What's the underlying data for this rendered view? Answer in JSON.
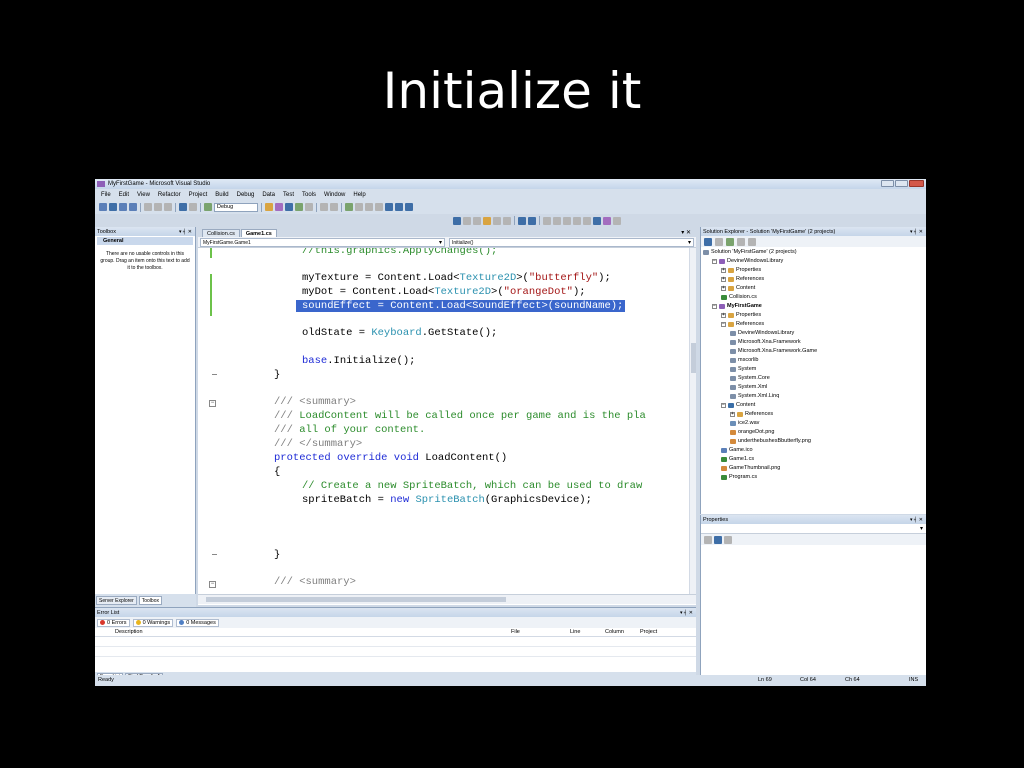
{
  "slide": {
    "title": "Initialize it"
  },
  "window": {
    "title": "MyFirstGame - Microsoft Visual Studio"
  },
  "menu": [
    "File",
    "Edit",
    "View",
    "Refactor",
    "Project",
    "Build",
    "Debug",
    "Data",
    "Test",
    "Tools",
    "Window",
    "Help"
  ],
  "toolbar": {
    "config": "Debug"
  },
  "toolbox": {
    "title": "Toolbox",
    "group": "General",
    "note": "There are no usable controls in this group. Drag an item onto this text to add it to the toolbox.",
    "tabs": [
      "Server Explorer",
      "Toolbox"
    ]
  },
  "editor": {
    "tabs": [
      "Collision.cs",
      "Game1.cs"
    ],
    "class_combo": "MyFirstGame.Game1",
    "member_combo": "Initialize()"
  },
  "error_list": {
    "title": "Error List",
    "errors": "0 Errors",
    "warnings": "0 Warnings",
    "messages": "0 Messages",
    "columns": [
      "Description",
      "File",
      "Line",
      "Column",
      "Project"
    ],
    "tabs": [
      "Error List",
      "Find Results 1"
    ]
  },
  "solution_explorer": {
    "title": "Solution Explorer - Solution 'MyFirstGame' (2 projects)",
    "items": [
      "Solution 'MyFirstGame' (2 projects)",
      "DevineWindowsLibrary",
      "Properties",
      "References",
      "Content",
      "Collision.cs",
      "MyFirstGame",
      "Properties",
      "References",
      "DevineWindowsLibrary",
      "Microsoft.Xna.Framework",
      "Microsoft.Xna.Framework.Game",
      "mscorlib",
      "System",
      "System.Core",
      "System.Xml",
      "System.Xml.Linq",
      "Content",
      "References",
      "ice2.wav",
      "orangeDot.png",
      "underthebushesBbutterfly.png",
      "Game.ico",
      "Game1.cs",
      "GameThumbnail.png",
      "Program.cs"
    ]
  },
  "properties": {
    "title": "Properties"
  },
  "status": {
    "ready": "Ready",
    "ln": "Ln 69",
    "col": "Col 64",
    "ch": "Ch 64",
    "ins": "INS"
  },
  "code": {
    "l1_cm": "//this.graphics.ApplyChanges();",
    "l2_a": "myTexture = Content.Load<",
    "l2_ty": "Texture2D",
    "l2_b": ">(",
    "l2_str": "\"butterfly\"",
    "l2_c": ");",
    "l3_a": "myDot = Content.Load<",
    "l3_ty": "Texture2D",
    "l3_b": ">(",
    "l3_str": "\"orangeDot\"",
    "l3_c": ");",
    "l4_sel": "soundEffect = Content.Load<SoundEffect>(soundName);",
    "l5_a": "oldState = ",
    "l5_ty": "Keyboard",
    "l5_b": ".GetState();",
    "l6_kw": "base",
    "l6_a": ".Initialize();",
    "l7": "}",
    "l8_g": "/// ",
    "l8_cm": "<summary>",
    "l9_g": "/// ",
    "l9_cm": "LoadContent will be called once per game and is the pla",
    "l10_g": "/// ",
    "l10_cm": "all of your content.",
    "l11_g": "/// ",
    "l11_cm": "</summary>",
    "l12_kw1": "protected",
    "l12_kw2": "override",
    "l12_kw3": "void",
    "l12_a": "LoadContent()",
    "l13": "{",
    "l14_cm": "// Create a new SpriteBatch, which can be used to draw",
    "l15_a": "spriteBatch = ",
    "l15_kw": "new",
    "l15_ty": "SpriteBatch",
    "l15_b": "(GraphicsDevice);",
    "l16": "}",
    "l17": "/// <summary>"
  }
}
